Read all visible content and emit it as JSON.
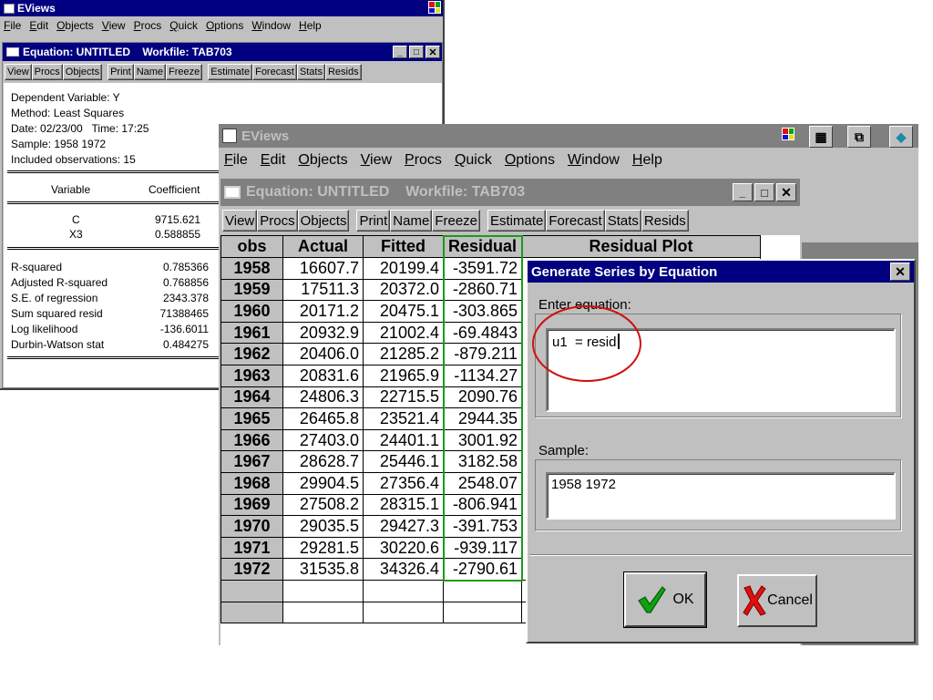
{
  "back_app": {
    "title": "EViews",
    "menu": [
      "File",
      "Edit",
      "Objects",
      "View",
      "Procs",
      "Quick",
      "Options",
      "Window",
      "Help"
    ]
  },
  "back_equation": {
    "title": "Equation: UNTITLED    Workfile: TAB703",
    "toolbar": [
      "View",
      "Procs",
      "Objects",
      "Print",
      "Name",
      "Freeze",
      "Estimate",
      "Forecast",
      "Stats",
      "Resids"
    ],
    "header_lines": [
      "Dependent Variable: Y",
      "Method: Least Squares",
      "Date: 02/23/00   Time: 17:25",
      "Sample: 1958 1972",
      "Included observations: 15"
    ],
    "col_variable": "Variable",
    "col_coefficient": "Coefficient",
    "coefficients": [
      {
        "name": "C",
        "value": "9715.621"
      },
      {
        "name": "X3",
        "value": "0.588855"
      }
    ],
    "stats": [
      {
        "label": "R-squared",
        "value": "0.785366"
      },
      {
        "label": "Adjusted R-squared",
        "value": "0.768856"
      },
      {
        "label": "S.E. of regression",
        "value": "2343.378"
      },
      {
        "label": "Sum squared resid",
        "value": "71388465"
      },
      {
        "label": "Log likelihood",
        "value": "-136.6011"
      },
      {
        "label": "Durbin-Watson stat",
        "value": "0.484275"
      }
    ]
  },
  "front_app": {
    "title": "EViews",
    "menu": [
      "File",
      "Edit",
      "Objects",
      "View",
      "Procs",
      "Quick",
      "Options",
      "Window",
      "Help"
    ]
  },
  "front_equation": {
    "title": "Equation: UNTITLED    Workfile: TAB703",
    "toolbar": [
      "View",
      "Procs",
      "Objects",
      "Print",
      "Name",
      "Freeze",
      "Estimate",
      "Forecast",
      "Stats",
      "Resids"
    ],
    "columns": [
      "obs",
      "Actual",
      "Fitted",
      "Residual",
      "Residual Plot"
    ],
    "rows": [
      {
        "obs": "1958",
        "actual": "16607.7",
        "fitted": "20199.4",
        "residual": "-3591.72"
      },
      {
        "obs": "1959",
        "actual": "17511.3",
        "fitted": "20372.0",
        "residual": "-2860.71"
      },
      {
        "obs": "1960",
        "actual": "20171.2",
        "fitted": "20475.1",
        "residual": "-303.865"
      },
      {
        "obs": "1961",
        "actual": "20932.9",
        "fitted": "21002.4",
        "residual": "-69.4843"
      },
      {
        "obs": "1962",
        "actual": "20406.0",
        "fitted": "21285.2",
        "residual": "-879.211"
      },
      {
        "obs": "1963",
        "actual": "20831.6",
        "fitted": "21965.9",
        "residual": "-1134.27"
      },
      {
        "obs": "1964",
        "actual": "24806.3",
        "fitted": "22715.5",
        "residual": "2090.76"
      },
      {
        "obs": "1965",
        "actual": "26465.8",
        "fitted": "23521.4",
        "residual": "2944.35"
      },
      {
        "obs": "1966",
        "actual": "27403.0",
        "fitted": "24401.1",
        "residual": "3001.92"
      },
      {
        "obs": "1967",
        "actual": "28628.7",
        "fitted": "25446.1",
        "residual": "3182.58"
      },
      {
        "obs": "1968",
        "actual": "29904.5",
        "fitted": "27356.4",
        "residual": "2548.07"
      },
      {
        "obs": "1969",
        "actual": "27508.2",
        "fitted": "28315.1",
        "residual": "-806.941"
      },
      {
        "obs": "1970",
        "actual": "29035.5",
        "fitted": "29427.3",
        "residual": "-391.753"
      },
      {
        "obs": "1971",
        "actual": "29281.5",
        "fitted": "30220.6",
        "residual": "-939.117"
      },
      {
        "obs": "1972",
        "actual": "31535.8",
        "fitted": "34326.4",
        "residual": "-2790.61"
      }
    ]
  },
  "dialog": {
    "title": "Generate Series by Equation",
    "equation_label": "Enter equation:",
    "equation_value": "u1  = resid",
    "sample_label": "Sample:",
    "sample_value": "1958 1972",
    "ok_label": "OK",
    "cancel_label": "Cancel"
  },
  "colors": {
    "title_active": "#000080",
    "face": "#c0c0c0",
    "highlight_circle": "#d01010",
    "residual_box": "#1a9a1a"
  }
}
